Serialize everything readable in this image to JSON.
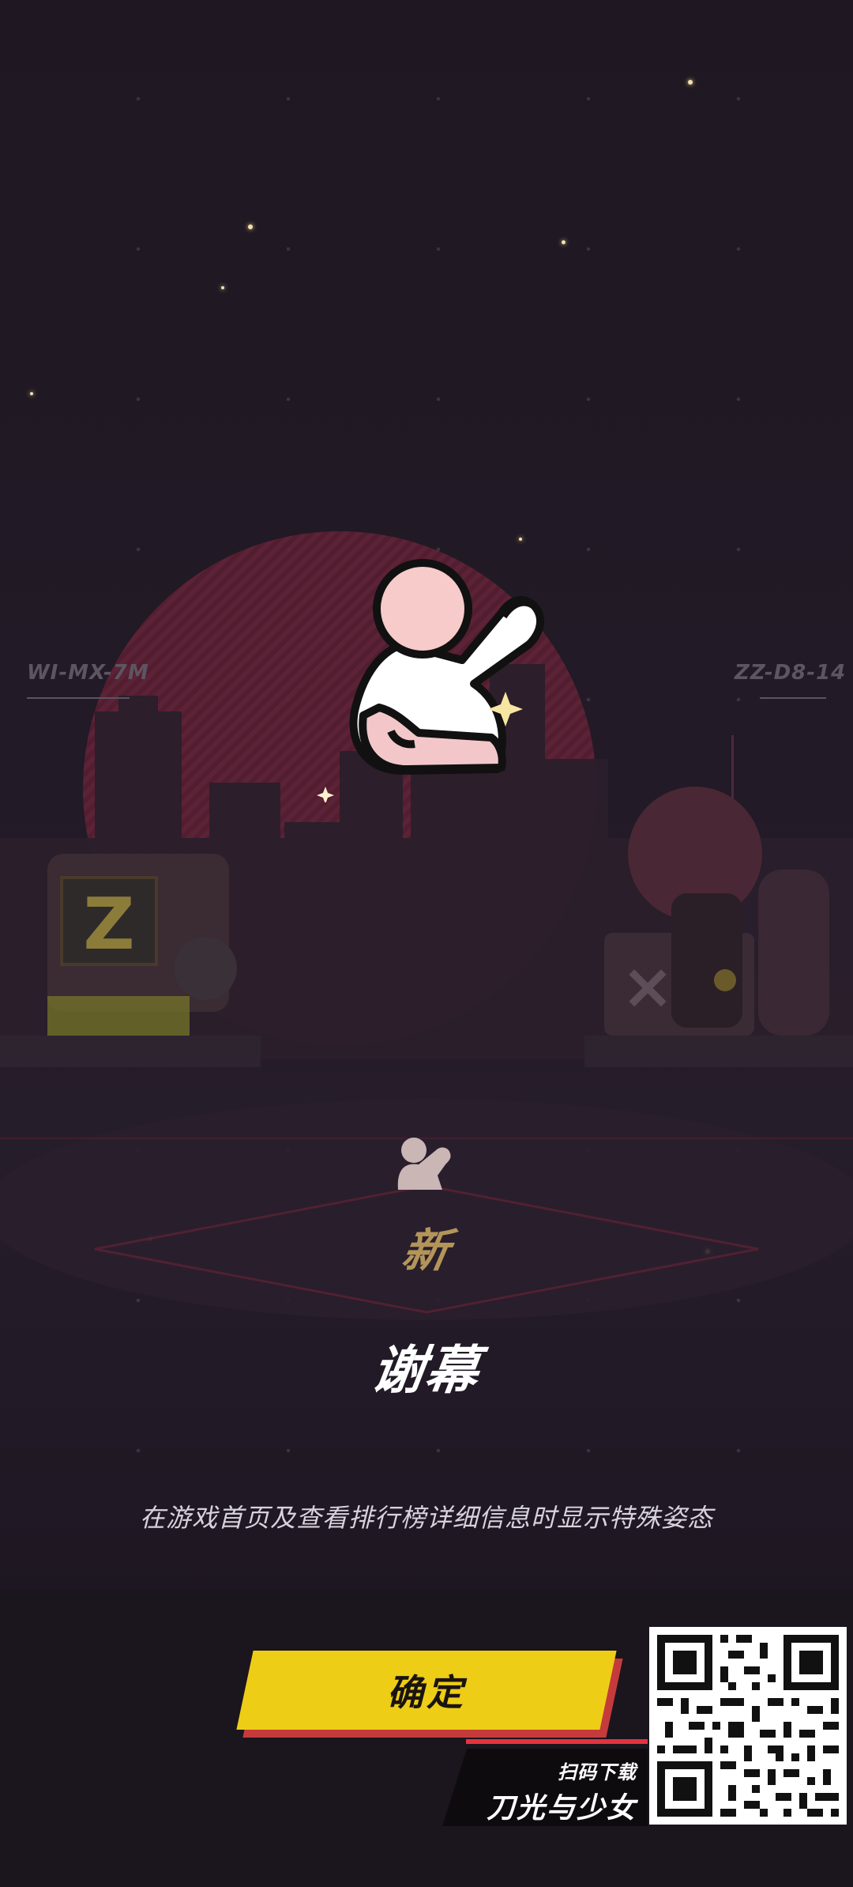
{
  "scene": {
    "left_code": "WI-MX-7M",
    "right_code": "ZZ-D8-14"
  },
  "reward": {
    "icon": "waving-character-icon",
    "badge_label": "新",
    "title": "谢幕",
    "description": "在游戏首页及查看排行榜详细信息时显示特殊姿态"
  },
  "actions": {
    "confirm_label": "确定"
  },
  "promo": {
    "caption": "扫码下载",
    "game_name": "刀光与少女",
    "qr_icon": "qr-code-icon"
  },
  "colors": {
    "background": "#1c1520",
    "accent_yellow": "#eecd17",
    "accent_red": "#e3333f",
    "badge_gold": "#b3955a",
    "sun_red": "#5b1f31"
  }
}
